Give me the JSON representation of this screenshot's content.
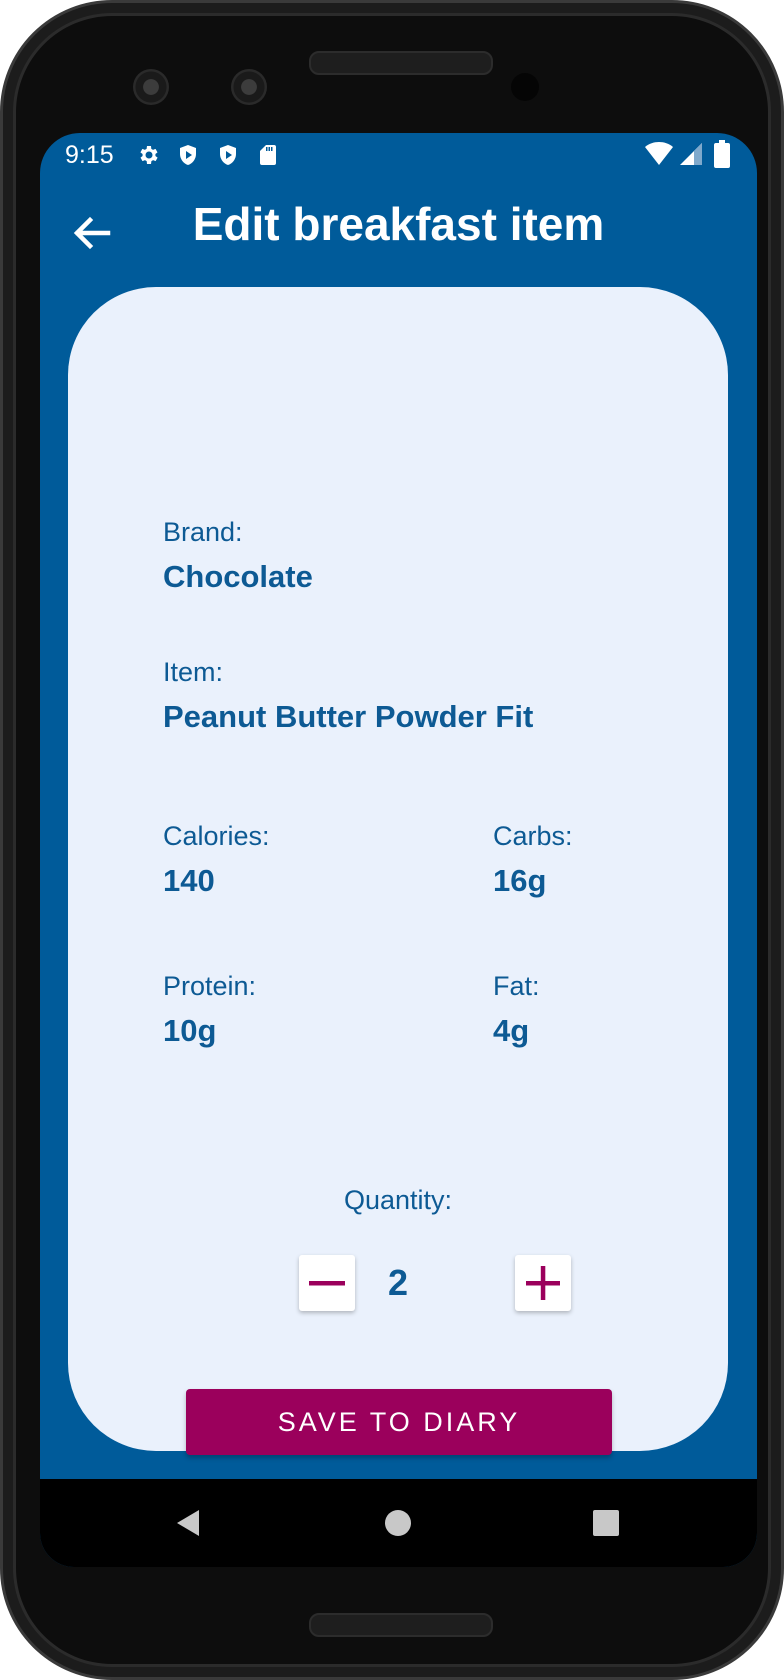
{
  "status_bar": {
    "time": "9:15",
    "left_icons": [
      "gear-icon",
      "shield-play-icon",
      "shield-play-icon",
      "sd-card-icon"
    ],
    "right_icons": [
      "wifi-icon",
      "cell-signal-icon",
      "battery-icon"
    ]
  },
  "app_bar": {
    "title": "Edit breakfast item",
    "back_icon": "arrow-back-icon"
  },
  "item": {
    "brand_label": "Brand:",
    "brand_value": "Chocolate",
    "item_label": "Item:",
    "item_value": "Peanut Butter Powder Fit",
    "calories_label": "Calories:",
    "calories_value": "140",
    "carbs_label": "Carbs:",
    "carbs_value": "16g",
    "protein_label": "Protein:",
    "protein_value": "10g",
    "fat_label": "Fat:",
    "fat_value": "4g"
  },
  "quantity": {
    "label": "Quantity:",
    "value": "2",
    "decrement_icon": "minus-icon",
    "increment_icon": "plus-icon"
  },
  "save_button": {
    "label": "SAVE TO DIARY"
  },
  "nav_bar": {
    "icons": [
      "nav-back-triangle-icon",
      "nav-home-circle-icon",
      "nav-recents-square-icon"
    ]
  },
  "colors": {
    "primary": "#005b9a",
    "card_background": "#eaf1fc",
    "text": "#0d5a94",
    "accent": "#9b005c"
  }
}
